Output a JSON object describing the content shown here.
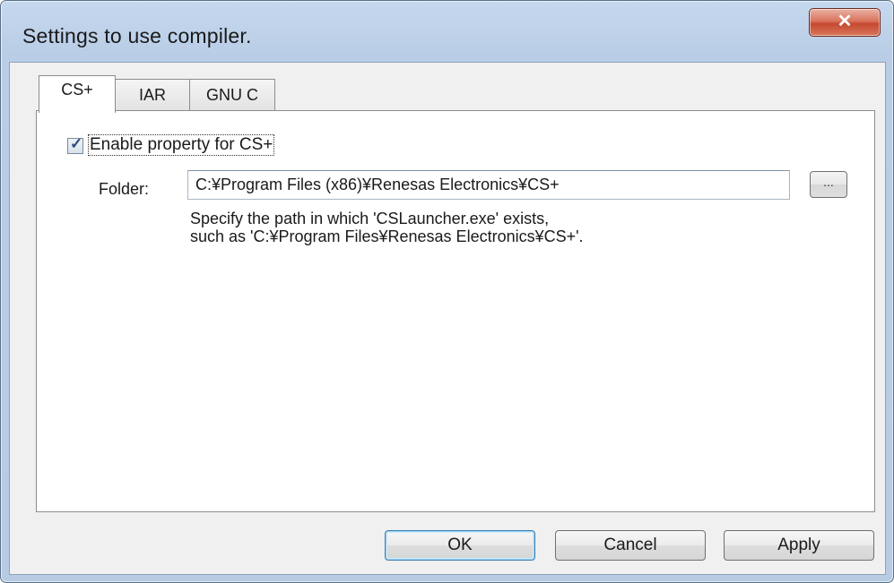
{
  "window": {
    "title": "Settings to use compiler.",
    "close_glyph": "✕"
  },
  "tabs": [
    {
      "label": "CS+",
      "active": true
    },
    {
      "label": "IAR",
      "active": false
    },
    {
      "label": "GNU C",
      "active": false
    }
  ],
  "cs_tab": {
    "enable_checkbox": {
      "label": "Enable property for CS+",
      "checked": true
    },
    "folder": {
      "label": "Folder:",
      "value": "C:¥Program Files (x86)¥Renesas Electronics¥CS+",
      "browse_label": "..."
    },
    "hint_line1": "Specify the path in which 'CSLauncher.exe' exists,",
    "hint_line2": "such as 'C:¥Program Files¥Renesas Electronics¥CS+'."
  },
  "buttons": {
    "ok": "OK",
    "cancel": "Cancel",
    "apply": "Apply"
  },
  "colors": {
    "frame": "#b9cde6",
    "close_button": "#c44a30",
    "default_button_border": "#3c7fb1"
  }
}
